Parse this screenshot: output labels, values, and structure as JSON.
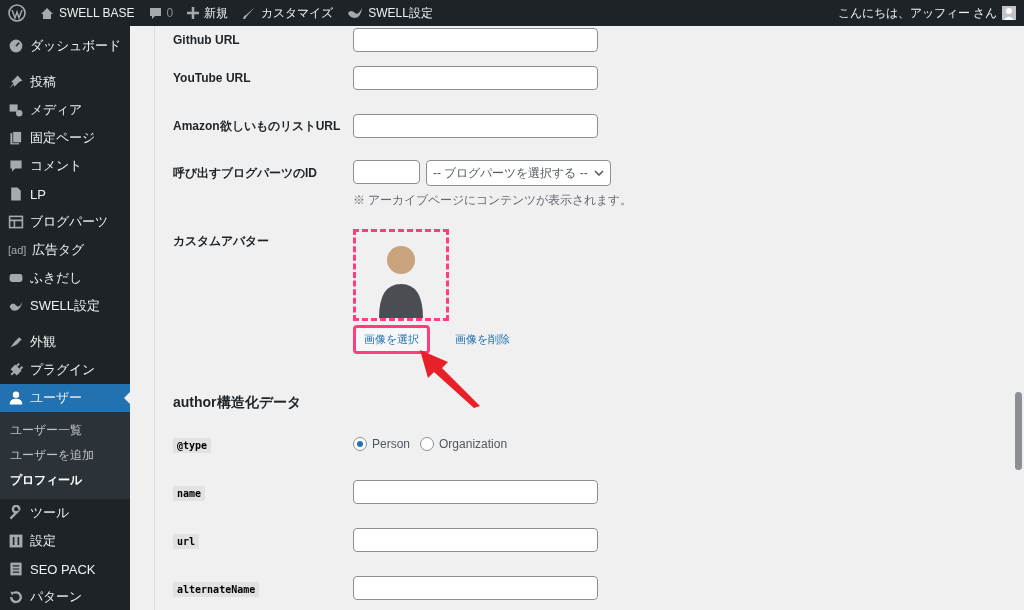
{
  "admin_bar": {
    "site": "SWELL BASE",
    "comments": "0",
    "new": "新規",
    "customize": "カスタマイズ",
    "swell": "SWELL設定",
    "greeting": "こんにちは、アッフィー さん"
  },
  "sidebar": {
    "groups": [
      {
        "items": [
          {
            "label": "ダッシュボード",
            "selected": false
          }
        ]
      },
      {
        "items": [
          {
            "label": "投稿",
            "selected": false
          },
          {
            "label": "メディア",
            "selected": false
          },
          {
            "label": "固定ページ",
            "selected": false
          },
          {
            "label": "コメント",
            "selected": false
          },
          {
            "label": "LP",
            "selected": false
          },
          {
            "label": "ブログパーツ",
            "selected": false
          },
          {
            "label": "広告タグ",
            "icon_text": "[ad]",
            "selected": false
          },
          {
            "label": "ふきだし",
            "selected": false
          },
          {
            "label": "SWELL設定",
            "selected": false
          }
        ]
      },
      {
        "items": [
          {
            "label": "外観",
            "selected": false
          },
          {
            "label": "プラグイン",
            "selected": false
          },
          {
            "label": "ユーザー",
            "selected": true,
            "children": [
              {
                "label": "ユーザー一覧",
                "selected": false
              },
              {
                "label": "ユーザーを追加",
                "selected": false
              },
              {
                "label": "プロフィール",
                "selected": true
              }
            ]
          },
          {
            "label": "ツール",
            "selected": false
          },
          {
            "label": "設定",
            "selected": false
          },
          {
            "label": "SEO PACK",
            "selected": false
          },
          {
            "label": "パターン",
            "selected": false
          }
        ]
      }
    ]
  },
  "profile_fields": [
    {
      "kind": "text",
      "label": "Github URL"
    },
    {
      "kind": "text",
      "label": "YouTube URL"
    },
    {
      "kind": "text",
      "label": "Amazon欲しいものリストURL"
    },
    {
      "kind": "blog_parts",
      "label": "呼び出すブログパーツのID",
      "select": "-- ブログパーツを選択する --",
      "note": "※ アーカイブページにコンテンツが表示されます。"
    },
    {
      "kind": "avatar",
      "label": "カスタムアバター",
      "highlighted": true,
      "buttons": [
        {
          "label": "画像を選択",
          "highlighted": true
        },
        {
          "label": "画像を削除",
          "highlighted": false
        }
      ]
    }
  ],
  "author_section": {
    "heading": "author構造化データ",
    "fields": [
      {
        "kind": "radio",
        "label": "@type",
        "options": [
          {
            "label": "Person",
            "selected": true
          },
          {
            "label": "Organization",
            "selected": false
          }
        ]
      },
      {
        "kind": "text",
        "label": "name"
      },
      {
        "kind": "text",
        "label": "url"
      },
      {
        "kind": "text",
        "label": "alternateName"
      }
    ]
  }
}
